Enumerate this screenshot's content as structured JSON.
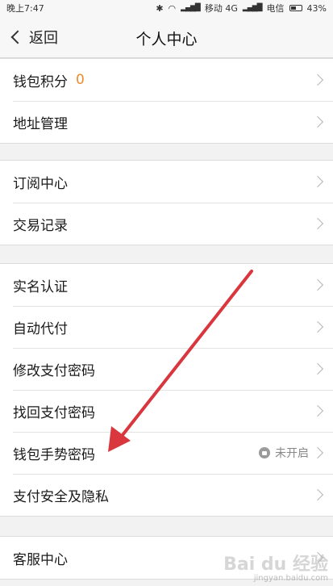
{
  "status_bar": {
    "time": "晚上7:47",
    "carrier1": "移动 4G",
    "carrier2": "电信",
    "battery": "43%"
  },
  "nav": {
    "back_label": "返回",
    "title": "个人中心"
  },
  "groups": [
    [
      {
        "label": "钱包积分",
        "value": "0"
      },
      {
        "label": "地址管理"
      }
    ],
    [
      {
        "label": "订阅中心"
      },
      {
        "label": "交易记录"
      }
    ],
    [
      {
        "label": "实名认证"
      },
      {
        "label": "自动代付"
      },
      {
        "label": "修改支付密码"
      },
      {
        "label": "找回支付密码"
      },
      {
        "label": "钱包手势密码",
        "status": "未开启"
      },
      {
        "label": "支付安全及隐私"
      }
    ],
    [
      {
        "label": "客服中心"
      }
    ]
  ],
  "watermark": {
    "brand": "Bai du 经验",
    "url": "jingyan.baidu.com"
  },
  "colors": {
    "accent_orange": "#f08b2a",
    "annotation_red": "#d9363e"
  }
}
